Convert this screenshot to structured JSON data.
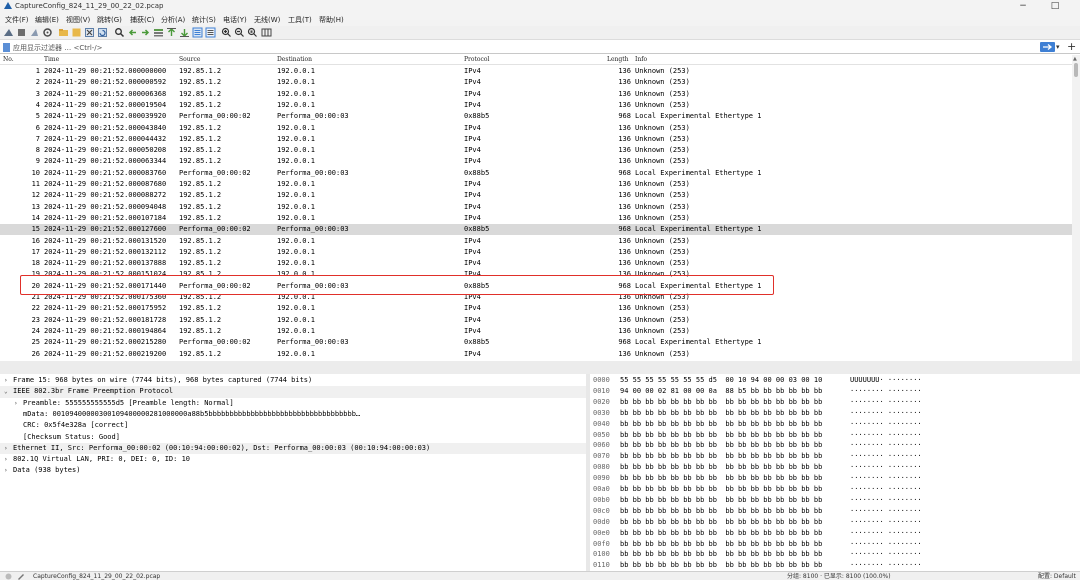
{
  "window": {
    "title": "CaptureConfig_824_11_29_00_22_02.pcap",
    "minimize": "−",
    "restore": "□"
  },
  "menu": [
    "文件(F)",
    "编辑(E)",
    "视图(V)",
    "跳转(G)",
    "捕获(C)",
    "分析(A)",
    "统计(S)",
    "电话(Y)",
    "无线(W)",
    "工具(T)",
    "帮助(H)"
  ],
  "filter": {
    "placeholder": "应用显示过滤器 … <Ctrl-/>",
    "add_label": "+"
  },
  "columns": {
    "no": "No.",
    "time": "Time",
    "source": "Source",
    "destination": "Destination",
    "protocol": "Protocol",
    "length": "Length",
    "info": "Info"
  },
  "packets": [
    {
      "no": "1",
      "time": "2024-11-29 00:21:52.000000000",
      "src": "192.85.1.2",
      "dst": "192.0.0.1",
      "proto": "IPv4",
      "len": "136",
      "info": "Unknown (253)"
    },
    {
      "no": "2",
      "time": "2024-11-29 00:21:52.000000592",
      "src": "192.85.1.2",
      "dst": "192.0.0.1",
      "proto": "IPv4",
      "len": "136",
      "info": "Unknown (253)"
    },
    {
      "no": "3",
      "time": "2024-11-29 00:21:52.000006368",
      "src": "192.85.1.2",
      "dst": "192.0.0.1",
      "proto": "IPv4",
      "len": "136",
      "info": "Unknown (253)"
    },
    {
      "no": "4",
      "time": "2024-11-29 00:21:52.000019504",
      "src": "192.85.1.2",
      "dst": "192.0.0.1",
      "proto": "IPv4",
      "len": "136",
      "info": "Unknown (253)"
    },
    {
      "no": "5",
      "time": "2024-11-29 00:21:52.000039920",
      "src": "Performa_00:00:02",
      "dst": "Performa_00:00:03",
      "proto": "0x88b5",
      "len": "968",
      "info": "Local Experimental Ethertype 1"
    },
    {
      "no": "6",
      "time": "2024-11-29 00:21:52.000043840",
      "src": "192.85.1.2",
      "dst": "192.0.0.1",
      "proto": "IPv4",
      "len": "136",
      "info": "Unknown (253)"
    },
    {
      "no": "7",
      "time": "2024-11-29 00:21:52.000044432",
      "src": "192.85.1.2",
      "dst": "192.0.0.1",
      "proto": "IPv4",
      "len": "136",
      "info": "Unknown (253)"
    },
    {
      "no": "8",
      "time": "2024-11-29 00:21:52.000050208",
      "src": "192.85.1.2",
      "dst": "192.0.0.1",
      "proto": "IPv4",
      "len": "136",
      "info": "Unknown (253)"
    },
    {
      "no": "9",
      "time": "2024-11-29 00:21:52.000063344",
      "src": "192.85.1.2",
      "dst": "192.0.0.1",
      "proto": "IPv4",
      "len": "136",
      "info": "Unknown (253)"
    },
    {
      "no": "10",
      "time": "2024-11-29 00:21:52.000083760",
      "src": "Performa_00:00:02",
      "dst": "Performa_00:00:03",
      "proto": "0x88b5",
      "len": "968",
      "info": "Local Experimental Ethertype 1"
    },
    {
      "no": "11",
      "time": "2024-11-29 00:21:52.000087680",
      "src": "192.85.1.2",
      "dst": "192.0.0.1",
      "proto": "IPv4",
      "len": "136",
      "info": "Unknown (253)"
    },
    {
      "no": "12",
      "time": "2024-11-29 00:21:52.000088272",
      "src": "192.85.1.2",
      "dst": "192.0.0.1",
      "proto": "IPv4",
      "len": "136",
      "info": "Unknown (253)"
    },
    {
      "no": "13",
      "time": "2024-11-29 00:21:52.000094048",
      "src": "192.85.1.2",
      "dst": "192.0.0.1",
      "proto": "IPv4",
      "len": "136",
      "info": "Unknown (253)"
    },
    {
      "no": "14",
      "time": "2024-11-29 00:21:52.000107184",
      "src": "192.85.1.2",
      "dst": "192.0.0.1",
      "proto": "IPv4",
      "len": "136",
      "info": "Unknown (253)"
    },
    {
      "no": "15",
      "time": "2024-11-29 00:21:52.000127600",
      "src": "Performa_00:00:02",
      "dst": "Performa_00:00:03",
      "proto": "0x88b5",
      "len": "968",
      "info": "Local Experimental Ethertype 1",
      "selected": true
    },
    {
      "no": "16",
      "time": "2024-11-29 00:21:52.000131520",
      "src": "192.85.1.2",
      "dst": "192.0.0.1",
      "proto": "IPv4",
      "len": "136",
      "info": "Unknown (253)"
    },
    {
      "no": "17",
      "time": "2024-11-29 00:21:52.000132112",
      "src": "192.85.1.2",
      "dst": "192.0.0.1",
      "proto": "IPv4",
      "len": "136",
      "info": "Unknown (253)"
    },
    {
      "no": "18",
      "time": "2024-11-29 00:21:52.000137888",
      "src": "192.85.1.2",
      "dst": "192.0.0.1",
      "proto": "IPv4",
      "len": "136",
      "info": "Unknown (253)"
    },
    {
      "no": "19",
      "time": "2024-11-29 00:21:52.000151024",
      "src": "192.85.1.2",
      "dst": "192.0.0.1",
      "proto": "IPv4",
      "len": "136",
      "info": "Unknown (253)"
    },
    {
      "no": "20",
      "time": "2024-11-29 00:21:52.000171440",
      "src": "Performa_00:00:02",
      "dst": "Performa_00:00:03",
      "proto": "0x88b5",
      "len": "968",
      "info": "Local Experimental Ethertype 1"
    },
    {
      "no": "21",
      "time": "2024-11-29 00:21:52.000175360",
      "src": "192.85.1.2",
      "dst": "192.0.0.1",
      "proto": "IPv4",
      "len": "136",
      "info": "Unknown (253)"
    },
    {
      "no": "22",
      "time": "2024-11-29 00:21:52.000175952",
      "src": "192.85.1.2",
      "dst": "192.0.0.1",
      "proto": "IPv4",
      "len": "136",
      "info": "Unknown (253)"
    },
    {
      "no": "23",
      "time": "2024-11-29 00:21:52.000181728",
      "src": "192.85.1.2",
      "dst": "192.0.0.1",
      "proto": "IPv4",
      "len": "136",
      "info": "Unknown (253)"
    },
    {
      "no": "24",
      "time": "2024-11-29 00:21:52.000194864",
      "src": "192.85.1.2",
      "dst": "192.0.0.1",
      "proto": "IPv4",
      "len": "136",
      "info": "Unknown (253)"
    },
    {
      "no": "25",
      "time": "2024-11-29 00:21:52.000215280",
      "src": "Performa_00:00:02",
      "dst": "Performa_00:00:03",
      "proto": "0x88b5",
      "len": "968",
      "info": "Local Experimental Ethertype 1"
    },
    {
      "no": "26",
      "time": "2024-11-29 00:21:52.000219200",
      "src": "192.85.1.2",
      "dst": "192.0.0.1",
      "proto": "IPv4",
      "len": "136",
      "info": "Unknown (253)"
    }
  ],
  "details": [
    {
      "arrow": "›",
      "indent": 0,
      "text": "Frame 15: 968 bytes on wire (7744 bits), 968 bytes captured (7744 bits)"
    },
    {
      "arrow": "⌄",
      "indent": 0,
      "text": "IEEE 802.3br Frame Preemption Protocol",
      "highlight": true
    },
    {
      "arrow": "›",
      "indent": 1,
      "text": "Preamble: 555555555555d5 [Preamble length: Normal]"
    },
    {
      "arrow": "",
      "indent": 1,
      "text": "mData: 00109400000300109400000281000000a88b5bbbbbbbbbbbbbbbbbbbbbbbbbbbbbbbbbbb…"
    },
    {
      "arrow": "",
      "indent": 1,
      "text": "CRC: 0x5f4e328a [correct]"
    },
    {
      "arrow": "",
      "indent": 1,
      "text": "[Checksum Status: Good]"
    },
    {
      "arrow": "›",
      "indent": 0,
      "text": "Ethernet II, Src: Performa_00:00:02 (00:10:94:00:00:02), Dst: Performa_00:00:03 (00:10:94:00:00:03)",
      "highlight": true
    },
    {
      "arrow": "›",
      "indent": 0,
      "text": "802.1Q Virtual LAN, PRI: 0, DEI: 0, ID: 10"
    },
    {
      "arrow": "›",
      "indent": 0,
      "text": "Data (938 bytes)"
    }
  ],
  "bytes": [
    {
      "off": "0000",
      "hex": "55 55 55 55 55 55 55 d5  00 10 94 00 00 03 00 10",
      "ascii": "UUUUUUU· ········"
    },
    {
      "off": "0010",
      "hex": "94 00 00 02 81 00 00 0a  88 b5 bb bb bb bb bb bb",
      "ascii": "········ ········"
    },
    {
      "off": "0020",
      "hex": "bb bb bb bb bb bb bb bb  bb bb bb bb bb bb bb bb",
      "ascii": "········ ········"
    },
    {
      "off": "0030",
      "hex": "bb bb bb bb bb bb bb bb  bb bb bb bb bb bb bb bb",
      "ascii": "········ ········"
    },
    {
      "off": "0040",
      "hex": "bb bb bb bb bb bb bb bb  bb bb bb bb bb bb bb bb",
      "ascii": "········ ········"
    },
    {
      "off": "0050",
      "hex": "bb bb bb bb bb bb bb bb  bb bb bb bb bb bb bb bb",
      "ascii": "········ ········"
    },
    {
      "off": "0060",
      "hex": "bb bb bb bb bb bb bb bb  bb bb bb bb bb bb bb bb",
      "ascii": "········ ········"
    },
    {
      "off": "0070",
      "hex": "bb bb bb bb bb bb bb bb  bb bb bb bb bb bb bb bb",
      "ascii": "········ ········"
    },
    {
      "off": "0080",
      "hex": "bb bb bb bb bb bb bb bb  bb bb bb bb bb bb bb bb",
      "ascii": "········ ········"
    },
    {
      "off": "0090",
      "hex": "bb bb bb bb bb bb bb bb  bb bb bb bb bb bb bb bb",
      "ascii": "········ ········"
    },
    {
      "off": "00a0",
      "hex": "bb bb bb bb bb bb bb bb  bb bb bb bb bb bb bb bb",
      "ascii": "········ ········"
    },
    {
      "off": "00b0",
      "hex": "bb bb bb bb bb bb bb bb  bb bb bb bb bb bb bb bb",
      "ascii": "········ ········"
    },
    {
      "off": "00c0",
      "hex": "bb bb bb bb bb bb bb bb  bb bb bb bb bb bb bb bb",
      "ascii": "········ ········"
    },
    {
      "off": "00d0",
      "hex": "bb bb bb bb bb bb bb bb  bb bb bb bb bb bb bb bb",
      "ascii": "········ ········"
    },
    {
      "off": "00e0",
      "hex": "bb bb bb bb bb bb bb bb  bb bb bb bb bb bb bb bb",
      "ascii": "········ ········"
    },
    {
      "off": "00f0",
      "hex": "bb bb bb bb bb bb bb bb  bb bb bb bb bb bb bb bb",
      "ascii": "········ ········"
    },
    {
      "off": "0100",
      "hex": "bb bb bb bb bb bb bb bb  bb bb bb bb bb bb bb bb",
      "ascii": "········ ········"
    },
    {
      "off": "0110",
      "hex": "bb bb bb bb bb bb bb bb  bb bb bb bb bb bb bb bb",
      "ascii": "········ ········"
    },
    {
      "off": "0120",
      "hex": "bb bb bb bb bb bb bb bb  bb bb bb bb bb bb bb bb",
      "ascii": "········ ········"
    }
  ],
  "status": {
    "file": "CaptureConfig_824_11_29_00_22_02.pcap",
    "counts": "分组: 8100 · 已显示: 8100 (100.0%)",
    "profile": "配置: Default"
  },
  "colors": {
    "accent": "#3e7fd4",
    "selection_outline": "#e0302a",
    "selected_row": "#d9d9d9"
  },
  "icons": [
    "shark-fin-icon",
    "stop-icon",
    "restart-icon",
    "options-gear-icon",
    "open-folder-icon",
    "save-icon",
    "close-file-icon",
    "reload-icon",
    "find-icon",
    "go-back-icon",
    "go-forward-icon",
    "go-to-packet-icon",
    "first-packet-icon",
    "last-packet-icon",
    "autoscroll-icon",
    "colorize-icon",
    "zoom-in-icon",
    "zoom-out-icon",
    "zoom-reset-icon",
    "resize-columns-icon"
  ]
}
